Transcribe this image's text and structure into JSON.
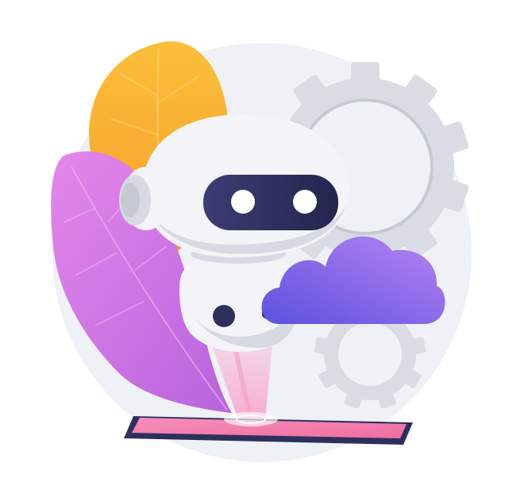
{
  "illustration": {
    "subject": "robot-assistant-with-cloud-and-gears",
    "colors": {
      "background": "#ffffff",
      "backdrop_circle": "#eef1f5",
      "gear": "#d9dce3",
      "gear_shadow": "#c5cad3",
      "orange_leaf": "#f7a829",
      "pink_leaf": "#d67be6",
      "robot_body": "#f3f4f8",
      "robot_shade": "#d7dae2",
      "visor": "#2d2f5e",
      "eyes": "#ffffff",
      "cloud_start": "#6a5be6",
      "cloud_end": "#b17cf2",
      "tablet_frame": "#2d2f5e",
      "tablet_screen": "#f48bb1",
      "hologram": "#f7c6dd"
    },
    "icons": [
      "robot-icon",
      "cloud-icon",
      "gear-icon",
      "tablet-icon",
      "leaf-icon"
    ]
  }
}
